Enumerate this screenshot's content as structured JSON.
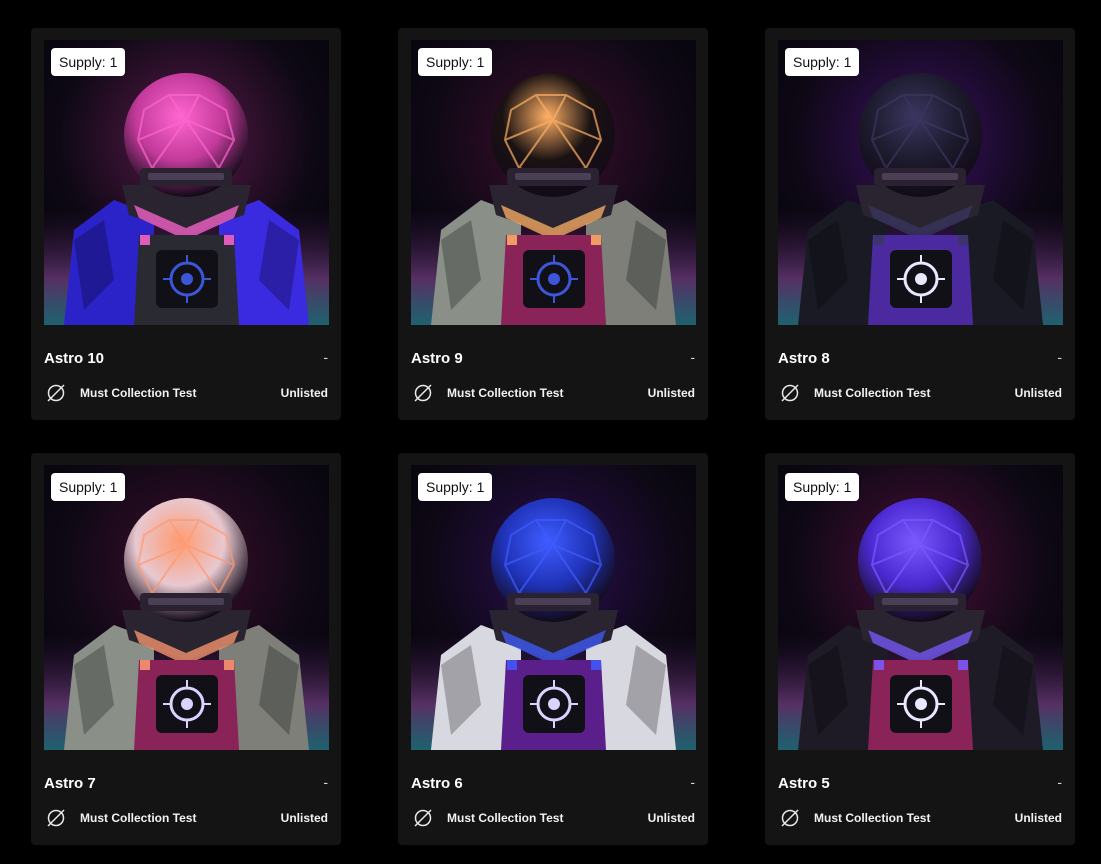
{
  "cards": [
    {
      "supply_label": "Supply: 1",
      "title": "Astro 10",
      "price": "-",
      "collection": "Must Collection Test",
      "status": "Unlisted",
      "icon": "collection-icon",
      "colors": {
        "helmet": "#c23a9a",
        "helmet_glow": "#ff66d0",
        "suit_left": "#2b22c8",
        "suit_right": "#3a2ae0",
        "chest": "#2a2a33",
        "emblem": "#3d55d8",
        "bg_glow": "#5a1a4a"
      }
    },
    {
      "supply_label": "Supply: 1",
      "title": "Astro 9",
      "price": "-",
      "collection": "Must Collection Test",
      "status": "Unlisted",
      "icon": "collection-icon",
      "colors": {
        "helmet": "#1a1212",
        "helmet_glow": "#ffb066",
        "suit_left": "#8a8f88",
        "suit_right": "#7d7f78",
        "chest": "#8a2458",
        "emblem": "#3d55d8",
        "bg_glow": "#3c0e2c"
      }
    },
    {
      "supply_label": "Supply: 1",
      "title": "Astro 8",
      "price": "-",
      "collection": "Must Collection Test",
      "status": "Unlisted",
      "icon": "collection-icon",
      "colors": {
        "helmet": "#1d1b2e",
        "helmet_glow": "#3a3660",
        "suit_left": "#1a1a24",
        "suit_right": "#1a1a24",
        "chest": "#4b2aa0",
        "emblem": "#e8e8ff",
        "bg_glow": "#3a1060"
      }
    },
    {
      "supply_label": "Supply: 1",
      "title": "Astro 7",
      "price": "-",
      "collection": "Must Collection Test",
      "status": "Unlisted",
      "icon": "collection-icon",
      "colors": {
        "helmet": "#e8c8d0",
        "helmet_glow": "#ff9a70",
        "suit_left": "#8a8f88",
        "suit_right": "#7d7f78",
        "chest": "#8a2458",
        "emblem": "#d9d3ff",
        "bg_glow": "#3c0e2c"
      }
    },
    {
      "supply_label": "Supply: 1",
      "title": "Astro 6",
      "price": "-",
      "collection": "Must Collection Test",
      "status": "Unlisted",
      "icon": "collection-icon",
      "colors": {
        "helmet": "#1f33b8",
        "helmet_glow": "#3f5cff",
        "suit_left": "#d8d8e0",
        "suit_right": "#d8d8e0",
        "chest": "#5a1f8a",
        "emblem": "#d9d3ff",
        "bg_glow": "#2a0e50"
      }
    },
    {
      "supply_label": "Supply: 1",
      "title": "Astro 5",
      "price": "-",
      "collection": "Must Collection Test",
      "status": "Unlisted",
      "icon": "collection-icon",
      "colors": {
        "helmet": "#4a2ad0",
        "helmet_glow": "#7a5aff",
        "suit_left": "#1e1a26",
        "suit_right": "#1e1a26",
        "chest": "#8a2458",
        "emblem": "#e8e8ff",
        "bg_glow": "#4a0e38"
      }
    }
  ]
}
